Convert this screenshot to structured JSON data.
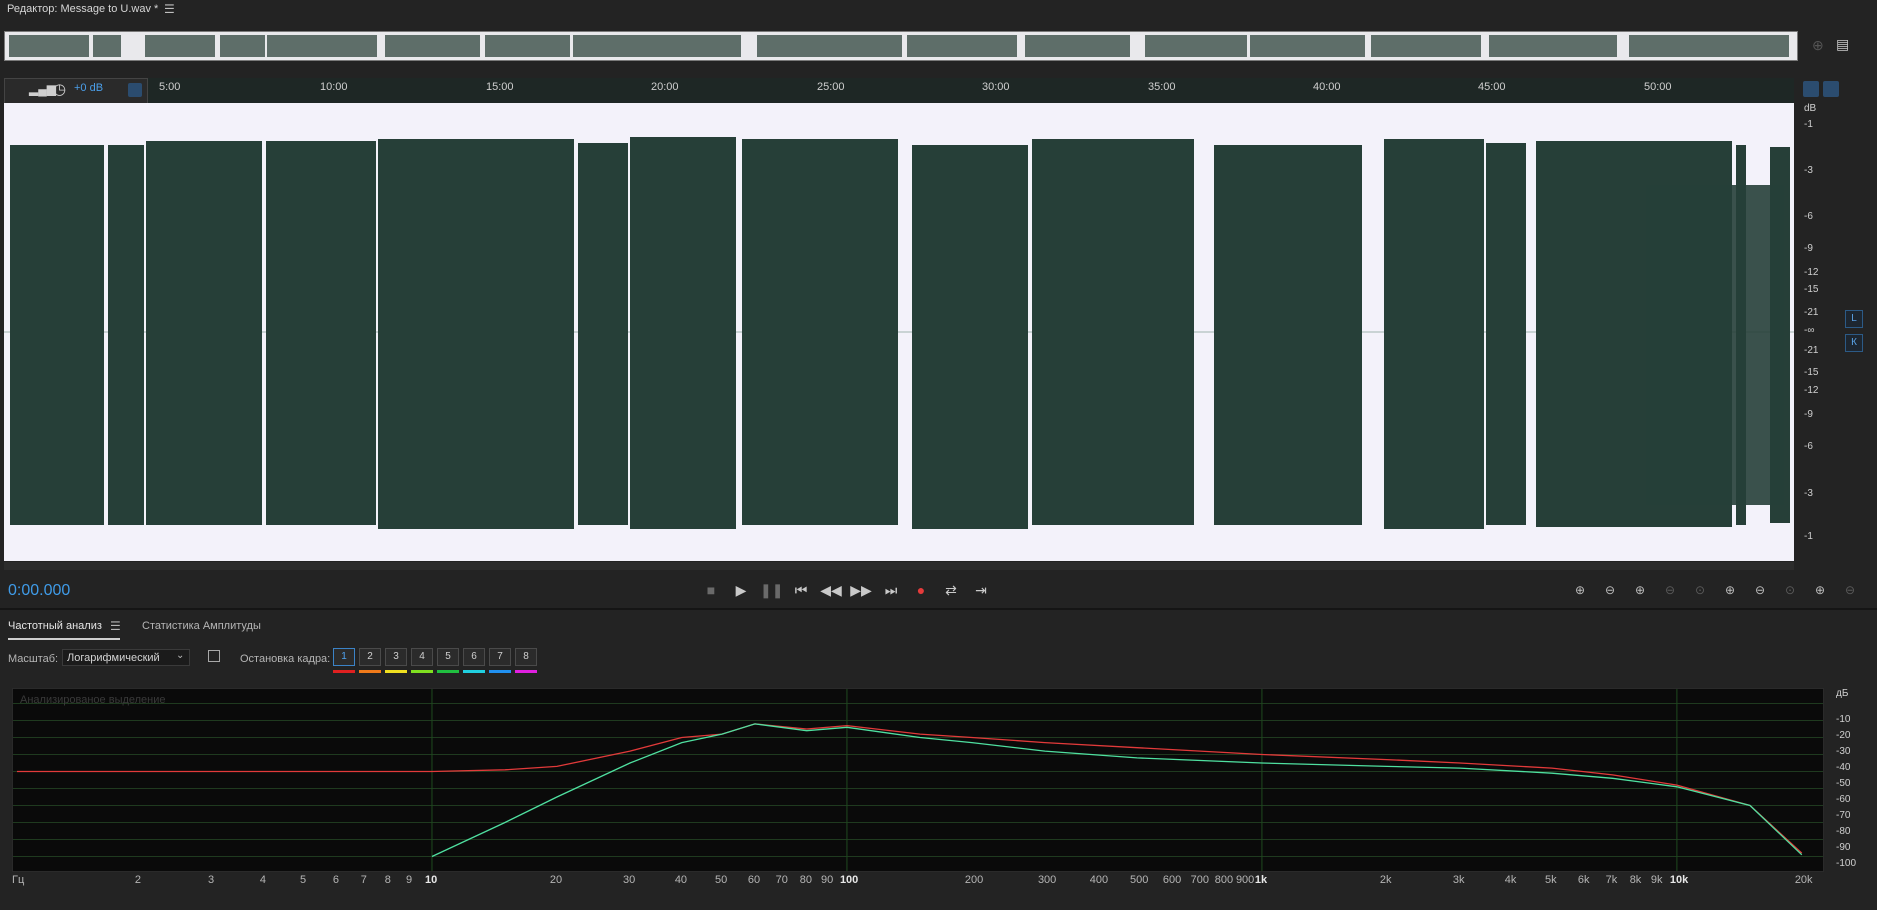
{
  "window": {
    "title": "Редактор: Message to U.wav *",
    "menu_icon": "hamburger-icon"
  },
  "ruler": {
    "ticks": [
      "5:00",
      "10:00",
      "15:00",
      "20:00",
      "25:00",
      "30:00",
      "35:00",
      "40:00",
      "45:00",
      "50:00"
    ],
    "gain": "+0 dB"
  },
  "db_scale": {
    "unit": "dB",
    "top": [
      "-1",
      "-3",
      "-6",
      "-9",
      "-12",
      "-15",
      "-21",
      "-∞"
    ],
    "bottom": [
      "-21",
      "-15",
      "-12",
      "-9",
      "-6",
      "-3",
      "-1"
    ]
  },
  "channels": {
    "left": "L",
    "right": "К"
  },
  "transport": {
    "timecode": "0:00.000",
    "buttons": [
      "stop",
      "play",
      "pause",
      "go-to-start",
      "rewind",
      "fast-forward",
      "go-to-end",
      "record",
      "loop",
      "skip-selection"
    ]
  },
  "panel": {
    "tabs": [
      "Частотный анализ",
      "Статистика Амплитуды"
    ],
    "scale_label": "Масштаб:",
    "scale_value": "Логарифмический",
    "freeze_label": "Остановка кадра:",
    "frames": [
      "1",
      "2",
      "3",
      "4",
      "5",
      "6",
      "7",
      "8"
    ],
    "frame_colors": [
      "#e02020",
      "#f07a1a",
      "#f0e020",
      "#80e020",
      "#20c040",
      "#20d0e0",
      "#2090f0",
      "#e020e0"
    ]
  },
  "spectrum": {
    "label": "Анализированое выделение",
    "db_unit": "дБ",
    "db_ticks": [
      "-10",
      "-20",
      "-30",
      "-40",
      "-50",
      "-60",
      "-70",
      "-80",
      "-90",
      "-100"
    ],
    "freq_unit": "Гц",
    "freq_ticks": [
      "2",
      "3",
      "4",
      "5",
      "6",
      "7",
      "8",
      "9",
      "10",
      "20",
      "30",
      "40",
      "50",
      "60",
      "70",
      "80",
      "90",
      "100",
      "200",
      "300",
      "400",
      "500",
      "600",
      "700",
      "800",
      "900",
      "1k",
      "2k",
      "3k",
      "4k",
      "5k",
      "6k",
      "7k",
      "8k",
      "9k",
      "10k",
      "20k"
    ]
  },
  "chart_data": {
    "type": "line",
    "xscale": "log",
    "xlim": [
      1,
      22000
    ],
    "ylim": [
      -105,
      -5
    ],
    "xlabel": "Гц",
    "ylabel": "дБ",
    "series": [
      {
        "color": "#e23a3a",
        "x": [
          1,
          10,
          15,
          20,
          30,
          40,
          50,
          60,
          80,
          100,
          150,
          200,
          300,
          500,
          1000,
          2000,
          3000,
          5000,
          7000,
          10000,
          15000,
          20000
        ],
        "y": [
          -50,
          -50,
          -49,
          -47,
          -38,
          -30,
          -28,
          -22,
          -25,
          -23,
          -28,
          -30,
          -33,
          -36,
          -40,
          -43,
          -45,
          -48,
          -52,
          -58,
          -70,
          -98
        ]
      },
      {
        "color": "#4fe0a0",
        "x": [
          10,
          15,
          20,
          30,
          40,
          50,
          60,
          80,
          100,
          150,
          200,
          300,
          500,
          1000,
          2000,
          3000,
          5000,
          7000,
          10000,
          15000,
          20000
        ],
        "y": [
          -100,
          -80,
          -65,
          -45,
          -33,
          -28,
          -22,
          -26,
          -24,
          -30,
          -33,
          -38,
          -42,
          -45,
          -47,
          -48,
          -51,
          -54,
          -59,
          -70,
          -99
        ]
      }
    ]
  }
}
